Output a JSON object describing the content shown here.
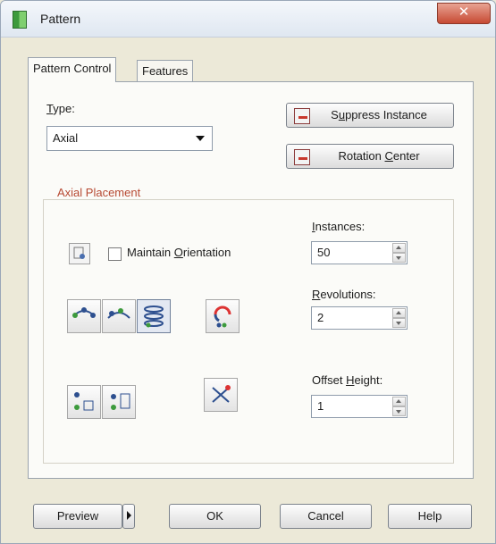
{
  "window": {
    "title": "Pattern",
    "close_glyph": "✕"
  },
  "tabs": [
    {
      "label": "Pattern Control",
      "active": true
    },
    {
      "label": "Features",
      "active": false
    }
  ],
  "type": {
    "label": "Type:",
    "underline": "T",
    "rest": "ype:",
    "value": "Axial"
  },
  "buttons": {
    "suppress": {
      "label": "Suppress Instance",
      "pre": "S",
      "u": "u",
      "post": "ppress Instance",
      "icon": "suppress-icon"
    },
    "rotation": {
      "label": "Rotation Center",
      "pre": "Rotation ",
      "u": "C",
      "post": "enter",
      "icon": "rotation-icon"
    }
  },
  "axial_placement": {
    "title": "Axial Placement",
    "maintain_orientation": {
      "label": "Maintain Orientation",
      "pre": "Maintain ",
      "u": "O",
      "post": "rientation",
      "checked": false
    }
  },
  "fields": {
    "instances": {
      "label": "Instances:",
      "u": "I",
      "rest": "nstances:",
      "value": "50"
    },
    "revolutions": {
      "label": "Revolutions:",
      "u": "R",
      "rest": "evolutions:",
      "value": "2"
    },
    "offset_height": {
      "label": "Offset Height:",
      "pre": "Offset ",
      "u": "H",
      "post": "eight:",
      "value": "1"
    }
  },
  "footer": {
    "preview": "Preview",
    "ok": "OK",
    "cancel": "Cancel",
    "help": "Help"
  },
  "colors": {
    "accent": "#b74a33",
    "close": "#c74a33"
  }
}
